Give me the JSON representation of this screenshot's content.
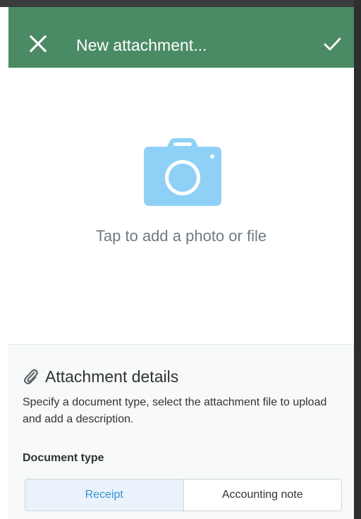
{
  "header": {
    "title": "New attachment...",
    "close_icon": "close-icon",
    "confirm_icon": "checkmark-icon",
    "background": "#4a8a64"
  },
  "photo_picker": {
    "icon": "camera-icon",
    "icon_color": "#8fd0f7",
    "prompt": "Tap to add a photo or file"
  },
  "details": {
    "icon": "paperclip-icon",
    "title": "Attachment details",
    "description": "Specify a document type, select the attachment file to upload and add a description.",
    "document_type_label": "Document type",
    "document_types": [
      "Receipt",
      "Accounting note"
    ],
    "selected_document_type": "Receipt",
    "accent": "#3a8fd0"
  }
}
